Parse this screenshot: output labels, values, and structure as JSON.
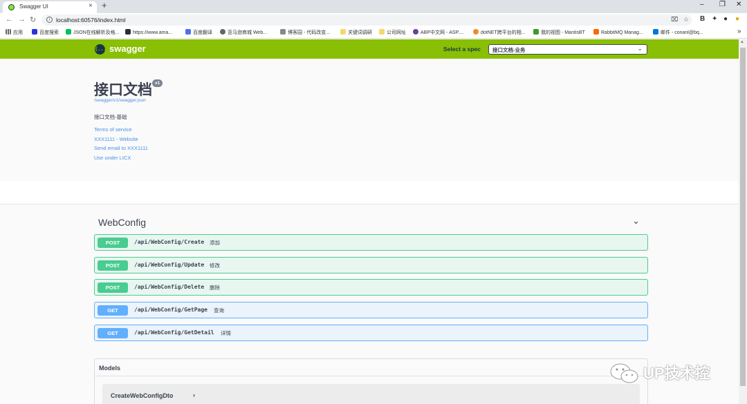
{
  "browser": {
    "tab_title": "Swagger UI",
    "url": "localhost:60576/index.html",
    "bookmarks": [
      "应用",
      "百度搜索",
      "JSON在线解析及格...",
      "https://www.ama...",
      "百度翻译",
      "亚马逊商城 Web...",
      "博客园 - 代码改变...",
      "关键词调研",
      "公司网址",
      "ABP中文网 - ASP....",
      "dotNET跨平台的相...",
      "我的视图 - MantisBT",
      "RabbitMQ Manag...",
      "邮件 - conanl@bq..."
    ],
    "bookmarks_more": "»"
  },
  "topbar": {
    "logo_text": "swagger",
    "logo_mark": "{...}",
    "spec_label": "Select a spec",
    "spec_value": "接口文档-业务"
  },
  "info": {
    "title": "接口文档",
    "version": "v1",
    "spec_url": "/swagger/v1/swagger.json",
    "description": "接口文档-基础",
    "terms": "Terms of service",
    "website": "XXX1111 - Website",
    "email": "Send email to XXX1111",
    "license": "Use under LICX"
  },
  "tag": {
    "name": "WebConfig"
  },
  "operations": [
    {
      "method": "POST",
      "path": "/api/WebConfig/Create",
      "summary": "添加"
    },
    {
      "method": "POST",
      "path": "/api/WebConfig/Update",
      "summary": "修改"
    },
    {
      "method": "POST",
      "path": "/api/WebConfig/Delete",
      "summary": "删除"
    },
    {
      "method": "GET",
      "path": "/api/WebConfig/GetPage",
      "summary": "查询"
    },
    {
      "method": "GET",
      "path": "/api/WebConfig/GetDetail",
      "summary": "详情"
    }
  ],
  "models": {
    "title": "Models",
    "items": [
      "CreateWebConfigDto"
    ]
  },
  "watermark": "UP技术控",
  "colors": {
    "topbar": "#89bf04",
    "post": "#49cc90",
    "get": "#61affe",
    "link": "#4990e2"
  }
}
